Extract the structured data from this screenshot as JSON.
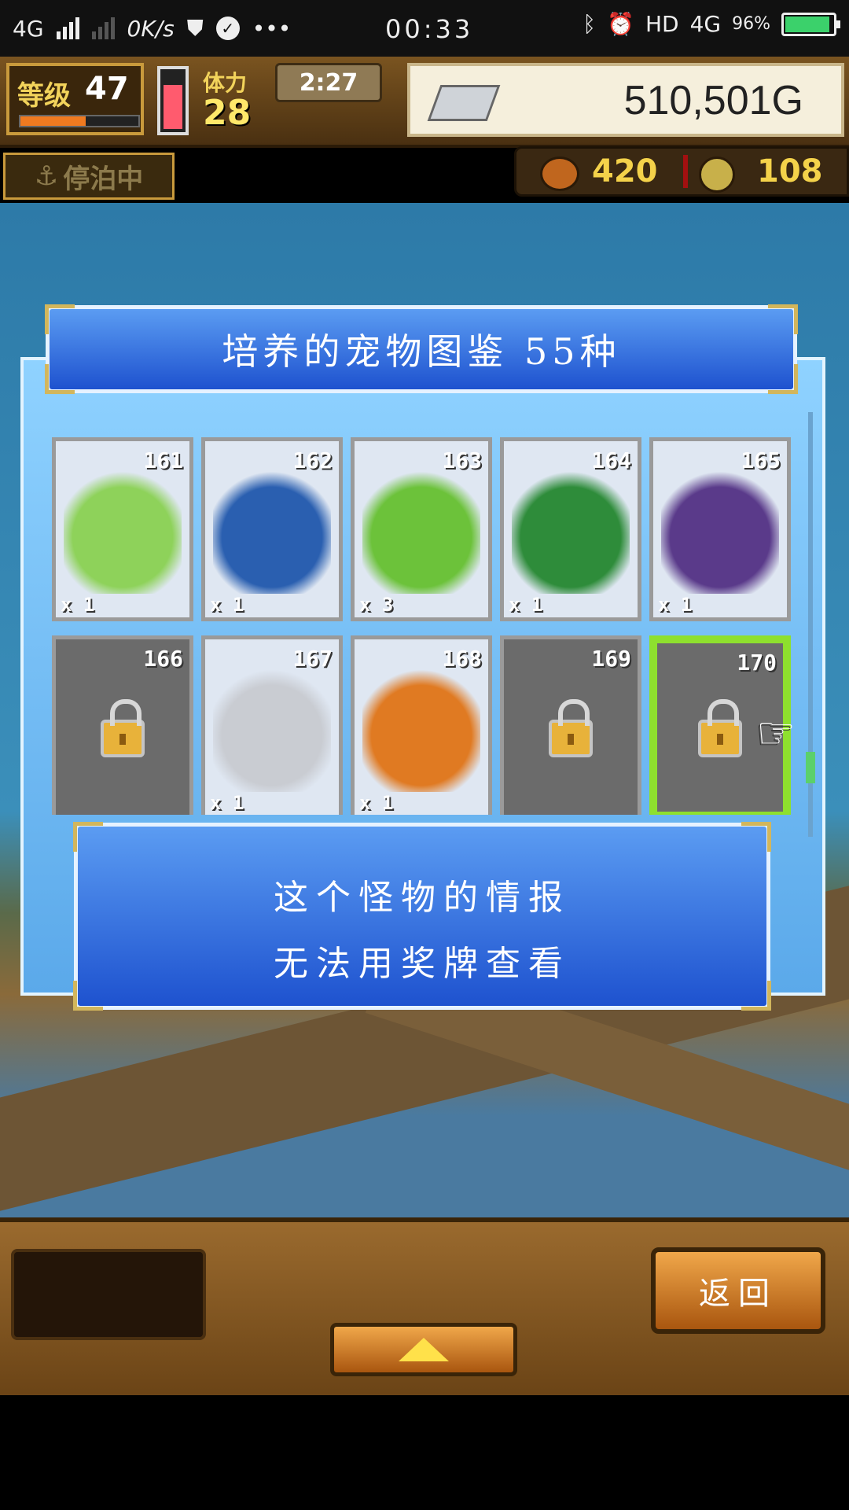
{
  "status_bar": {
    "network": "4G",
    "speed": "0K/s",
    "dots": "•••",
    "time": "00:33",
    "hd": "HD",
    "network2": "4G",
    "battery": "96%"
  },
  "hud": {
    "level_label": "等级",
    "level_value": "47",
    "stamina_label": "体力",
    "stamina_value": "28",
    "timer": "2:27",
    "gold": "510,501G"
  },
  "status_row": {
    "anchor_label": "停泊中",
    "food_value": "420",
    "medal_value": "108"
  },
  "dialog": {
    "title": "培养的宠物图鉴 55种",
    "cards": [
      {
        "number": "161",
        "count": "x 1",
        "locked": false,
        "color": "#8ed25a",
        "icon": "frog-monster"
      },
      {
        "number": "162",
        "count": "x 1",
        "locked": false,
        "color": "#2a5fb0",
        "icon": "blue-bird-monster"
      },
      {
        "number": "163",
        "count": "x 3",
        "locked": false,
        "color": "#6cc23a",
        "icon": "green-dinosaur-monster"
      },
      {
        "number": "164",
        "count": "x 1",
        "locked": false,
        "color": "#2e8c3a",
        "icon": "winged-dragon-monster"
      },
      {
        "number": "165",
        "count": "x 1",
        "locked": false,
        "color": "#5a3a8a",
        "icon": "block-golem-monster"
      },
      {
        "number": "166",
        "count": "",
        "locked": true,
        "selected": false
      },
      {
        "number": "167",
        "count": "x 1",
        "locked": false,
        "color": "#c9ccd2",
        "icon": "skull-spider-monster"
      },
      {
        "number": "168",
        "count": "x 1",
        "locked": false,
        "color": "#e07a22",
        "icon": "orange-dragon-monster"
      },
      {
        "number": "169",
        "count": "",
        "locked": true,
        "selected": false
      },
      {
        "number": "170",
        "count": "",
        "locked": true,
        "selected": true
      }
    ],
    "info_line1": "这个怪物的情报",
    "info_line2": "无法用奖牌查看"
  },
  "bottom": {
    "back_label": "返回"
  }
}
